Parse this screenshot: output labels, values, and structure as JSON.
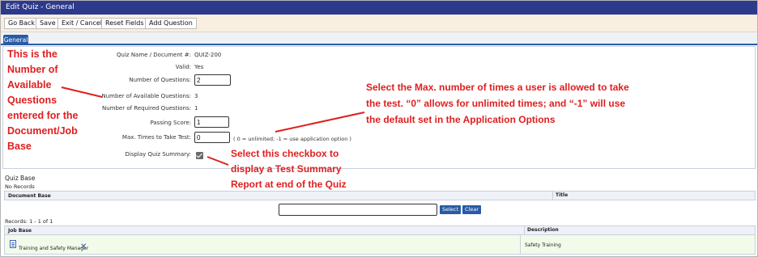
{
  "window": {
    "title": "Edit Quiz - General"
  },
  "toolbar": {
    "go_back": "Go Back",
    "save": "Save",
    "exit_cancel": "Exit / Cancel",
    "reset_fields": "Reset Fields",
    "add_question": "Add Question"
  },
  "tabs": [
    {
      "label": "General"
    }
  ],
  "form": {
    "quiz_name": {
      "label": "Quiz Name / Document #:",
      "value": "QUIZ-200"
    },
    "valid": {
      "label": "Valid:",
      "value": "Yes"
    },
    "num_questions": {
      "label": "Number of Questions:",
      "value": "2"
    },
    "num_available": {
      "label": "Number of Available Questions:",
      "value": "3"
    },
    "num_required": {
      "label": "Number of Required Questions:",
      "value": "1"
    },
    "passing_score": {
      "label": "Passing Score:",
      "value": "1"
    },
    "max_times": {
      "label": "Max. Times to Take Test:",
      "value": "0",
      "hint": "( 0 = unlimited; -1 = use application option )"
    },
    "display_summary": {
      "label": "Display Quiz Summary:",
      "checked": true
    }
  },
  "quiz_base": {
    "title": "Quiz Base",
    "empty": "No Records",
    "columns": {
      "document_base": "Document Base",
      "title": "Title"
    }
  },
  "search": {
    "value": "",
    "select_label": "Select",
    "clear_label": "Clear"
  },
  "job_base": {
    "records": "Records: 1 - 1 of 1",
    "columns": {
      "job_base": "Job Base",
      "description": "Description"
    },
    "rows": [
      {
        "job": "Training and Safety Manager",
        "description": "Safety Training"
      }
    ]
  },
  "annotations": {
    "left": [
      "This is the",
      "Number of",
      "Available",
      "Questions",
      "entered for the",
      "Document/Job",
      "Base"
    ],
    "right": [
      "Select the Max. number of times a user is allowed to take",
      "the test.  “0” allows for unlimited times; and “-1” will use",
      "the default set in the Application Options"
    ],
    "checkbox": [
      "Select this checkbox to",
      "display a Test Summary",
      "Report at end of the Quiz"
    ],
    "color": "#e01e1e"
  },
  "colors": {
    "title_bar": "#2d3a8c",
    "accent": "#2a5aa6",
    "toolbar_bg": "#f8efe1",
    "row_bg": "#f2fbea"
  }
}
